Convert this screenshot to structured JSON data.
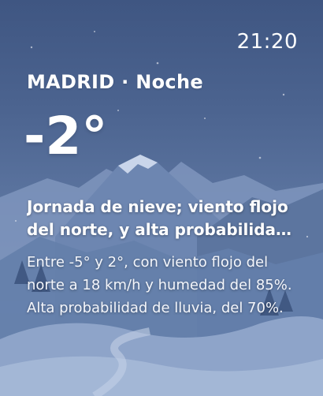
{
  "widget": {
    "time": "21:20",
    "location": "MADRID · Noche",
    "temperature": "-2°",
    "headline": "Jornada de nieve; viento flojo del norte, y alta probabilidad de lluvia",
    "detail": "Entre -5° y 2°, con viento flojo del norte a 18 km/h y humedad del 85%. Alta probabilidad de lluvia, del 70%.",
    "background_icon": "snowy-mountain-night-scene"
  },
  "colors": {
    "sky_top": "#3f5682",
    "sky_bottom": "#6f88b3",
    "mountain_far": "#8fa3c6",
    "mountain_mid": "#5f7aa4",
    "snow": "#dfe7f4",
    "text": "#ffffff"
  }
}
